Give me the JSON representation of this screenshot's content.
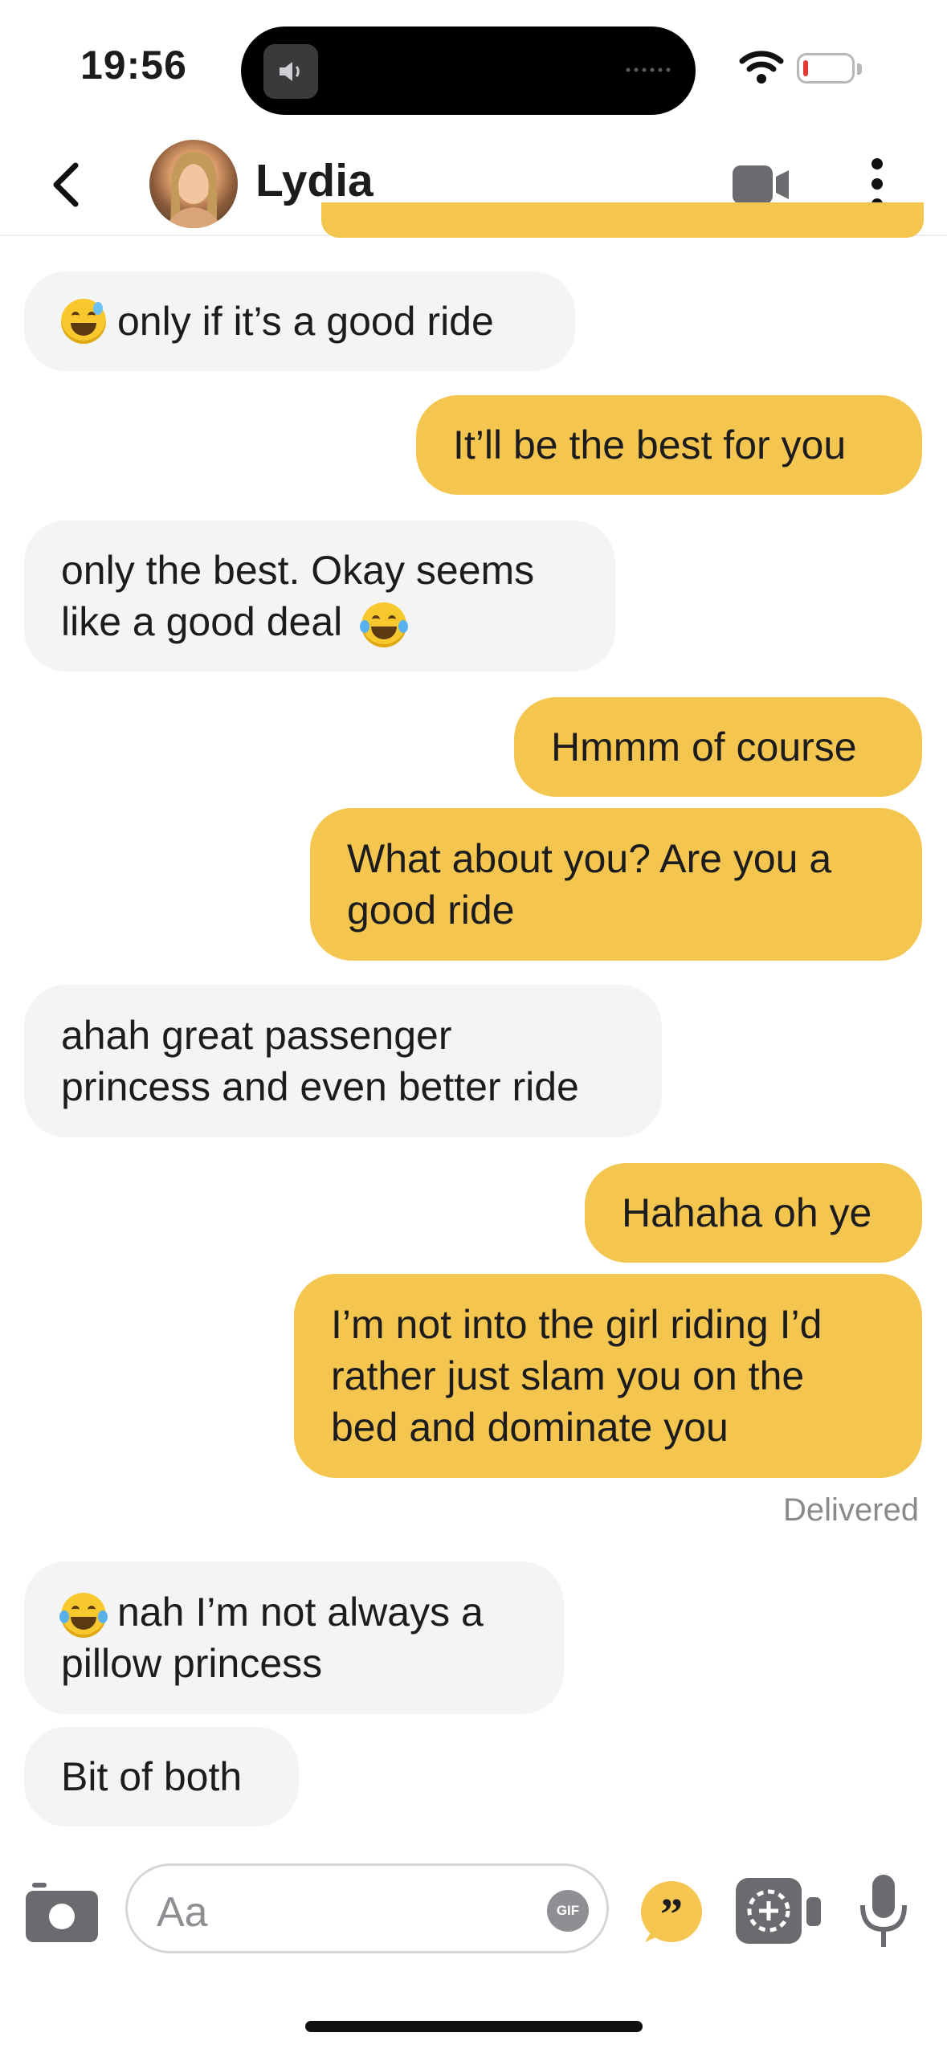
{
  "status": {
    "time": "19:56",
    "battery_color": "#e53935"
  },
  "header": {
    "contact_name": "Lydia",
    "back_icon": "chevron-left-icon",
    "video_icon": "video-camera-icon",
    "menu_icon": "more-vertical-icon"
  },
  "messages": [
    {
      "from": "them",
      "text": "only if it’s a good ride",
      "emoji": "sweat-smile-icon"
    },
    {
      "from": "me",
      "text": "It’ll be the best for you"
    },
    {
      "from": "them",
      "line1": "only the best. Okay seems",
      "line2": "like a good deal",
      "emoji": "tears-of-joy-icon"
    },
    {
      "from": "me",
      "text": "Hmmm of course"
    },
    {
      "from": "me",
      "line1": "What about you? Are you a",
      "line2": "good ride"
    },
    {
      "from": "them",
      "line1": "ahah great passenger",
      "line2": "princess and even better ride"
    },
    {
      "from": "me",
      "text": "Hahaha oh ye"
    },
    {
      "from": "me",
      "line1": "I’m not into the girl riding I’d",
      "line2": "rather just slam you on the",
      "line3": "bed and dominate you"
    },
    {
      "from": "them",
      "line1": "nah I’m not always a",
      "line2": "pillow princess",
      "emoji": "tears-of-joy-icon"
    },
    {
      "from": "them",
      "text": "Bit of both"
    }
  ],
  "delivered_label": "Delivered",
  "composer": {
    "placeholder": "Aa",
    "gif_label": "GIF"
  },
  "colors": {
    "accent": "#f4c64f",
    "incoming_bubble": "#f4f4f5"
  }
}
